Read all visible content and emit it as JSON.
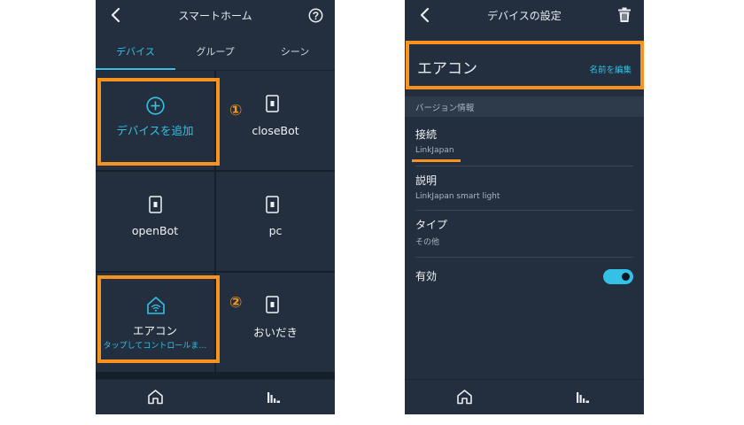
{
  "left": {
    "header": {
      "title": "スマートホーム"
    },
    "tabs": [
      {
        "label": "デバイス",
        "active": true
      },
      {
        "label": "グループ",
        "active": false
      },
      {
        "label": "シーン",
        "active": false
      }
    ],
    "tiles": {
      "add_device": "デバイスを追加",
      "closebot": "closeBot",
      "openbot": "openBot",
      "pc": "pc",
      "aircon": "エアコン",
      "aircon_sub": "タップしてコントロールま…",
      "oidaki": "おいだき"
    },
    "annotations": {
      "step1": "①",
      "step2": "②"
    },
    "bottom_nav": [
      {
        "icon": "home-icon"
      },
      {
        "icon": "devices-icon"
      }
    ]
  },
  "right": {
    "header": {
      "title": "デバイスの設定"
    },
    "device_name": "エアコン",
    "rename_link": "名前を編集",
    "section_header": "バージョン情報",
    "fields": [
      {
        "title": "接続",
        "value": "LinkJapan"
      },
      {
        "title": "説明",
        "value": "LinkJapan smart light"
      },
      {
        "title": "タイプ",
        "value": "その他"
      }
    ],
    "enabled": {
      "label": "有効",
      "on": true
    }
  },
  "colors": {
    "background": "#232f3e",
    "grid_gap": "#16202c",
    "accent": "#33c1e6",
    "highlight": "#f7931e",
    "text": "#f0f3f5",
    "muted": "#aab4bf"
  }
}
